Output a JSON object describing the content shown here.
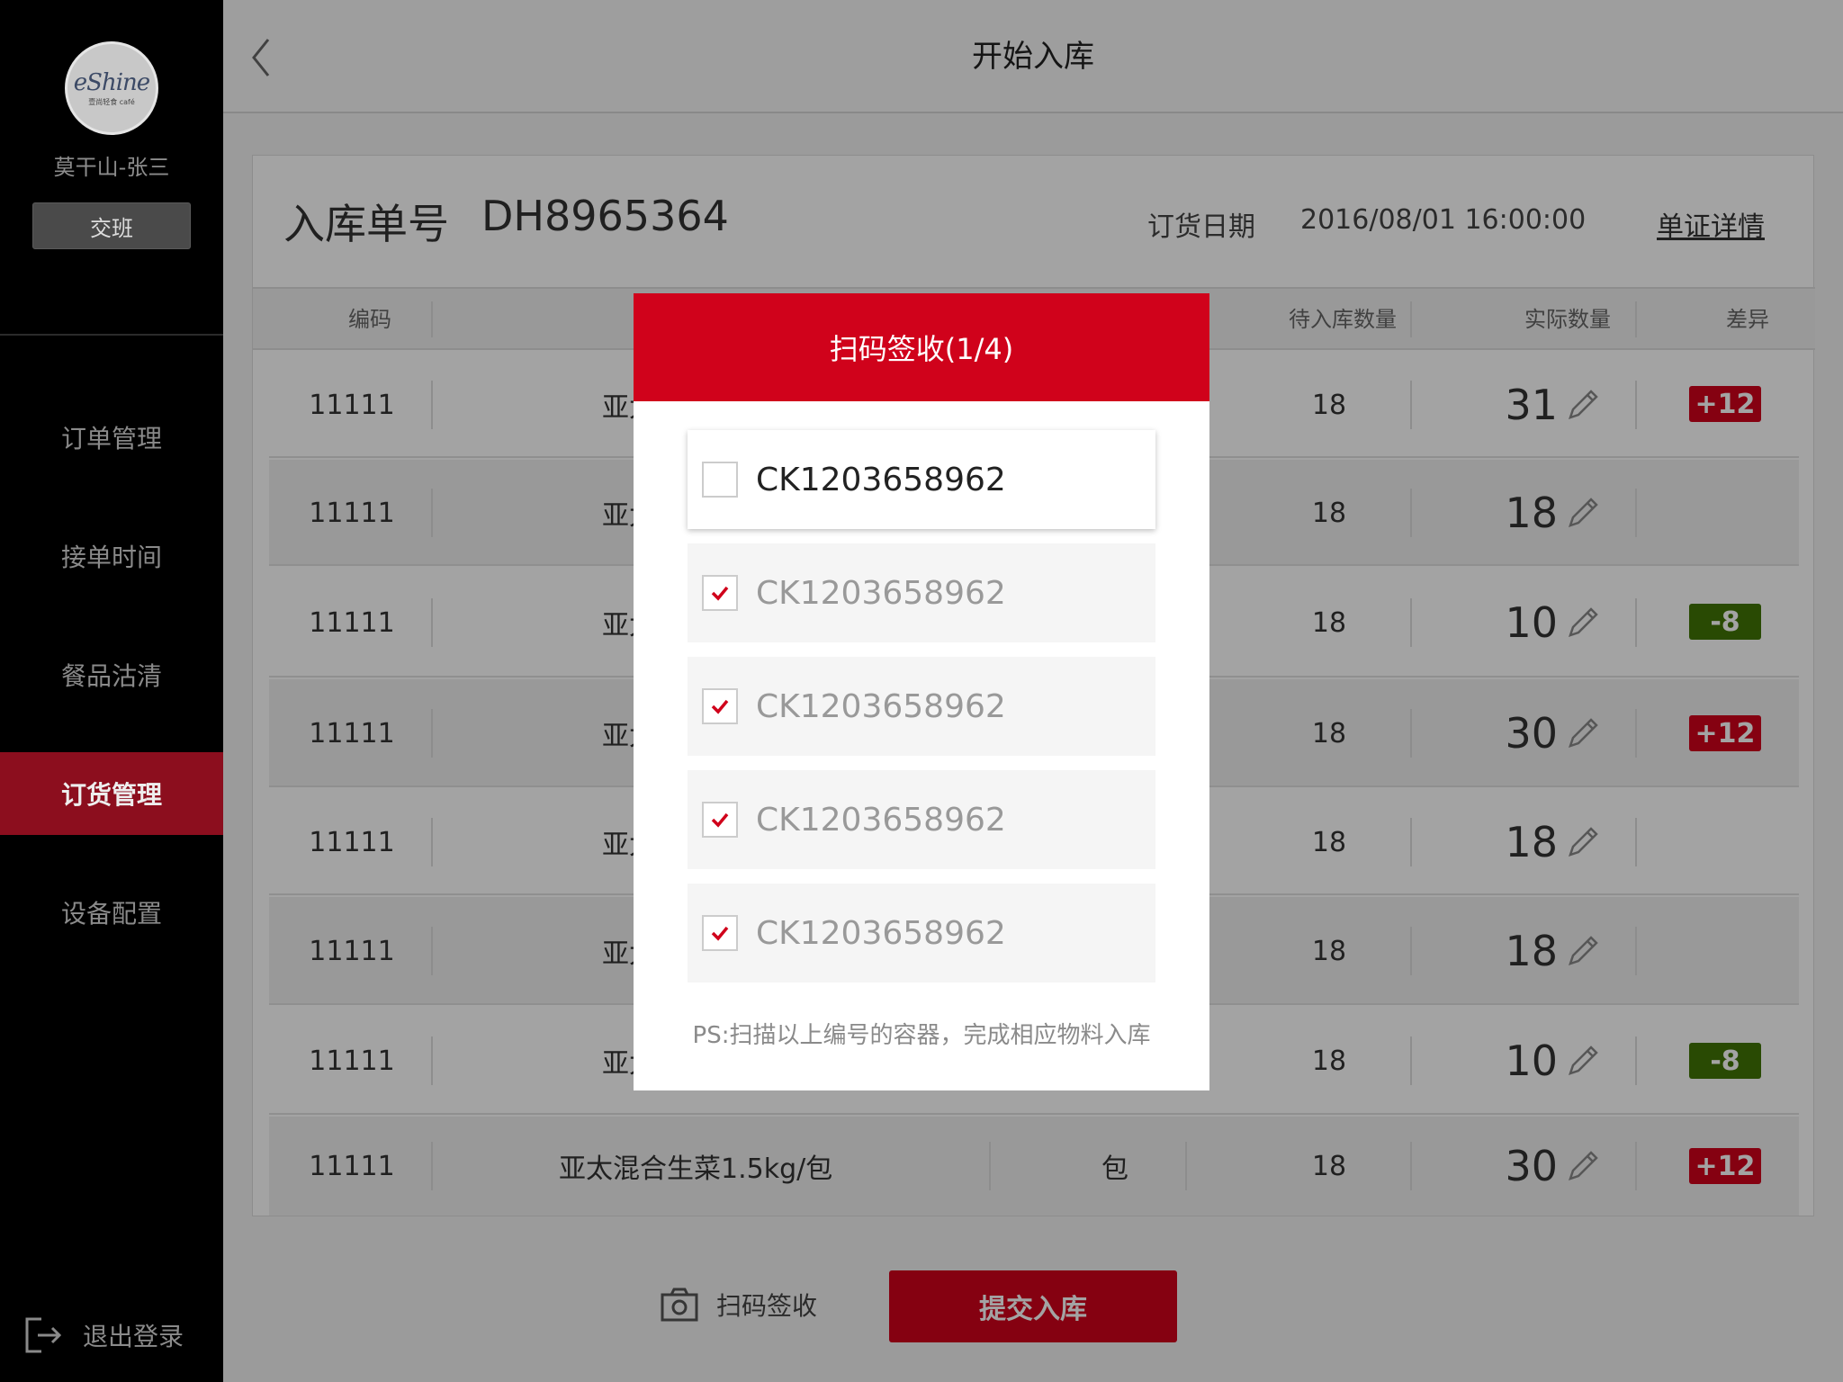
{
  "sidebar": {
    "logo_text": "eShine",
    "logo_sub": "壹尚轻食 café",
    "user_name": "莫干山-张三",
    "shift_label": "交班",
    "items": [
      {
        "label": "订单管理"
      },
      {
        "label": "接单时间"
      },
      {
        "label": "餐品沽清"
      },
      {
        "label": "订货管理"
      },
      {
        "label": "设备配置"
      }
    ],
    "active_index": 3,
    "logout_label": "退出登录"
  },
  "topbar": {
    "title": "开始入库"
  },
  "order": {
    "number_label": "入库单号",
    "number": "DH8965364",
    "date_label": "订货日期",
    "date": "2016/08/01 16:00:00",
    "detail_link": "单证详情"
  },
  "table": {
    "headers": {
      "code": "编码",
      "pending": "待入库数量",
      "actual": "实际数量",
      "diff": "差异"
    },
    "rows": [
      {
        "code": "11111",
        "name": "亚太",
        "pending": "18",
        "actual": "31",
        "diff": "+12"
      },
      {
        "code": "11111",
        "name": "亚太",
        "pending": "18",
        "actual": "18",
        "diff": ""
      },
      {
        "code": "11111",
        "name": "亚太",
        "pending": "18",
        "actual": "10",
        "diff": "-8"
      },
      {
        "code": "11111",
        "name": "亚太",
        "pending": "18",
        "actual": "30",
        "diff": "+12"
      },
      {
        "code": "11111",
        "name": "亚太",
        "pending": "18",
        "actual": "18",
        "diff": ""
      },
      {
        "code": "11111",
        "name": "亚太",
        "pending": "18",
        "actual": "18",
        "diff": ""
      },
      {
        "code": "11111",
        "name": "亚太",
        "pending": "18",
        "actual": "10",
        "diff": "-8"
      },
      {
        "code": "11111",
        "name": "亚太混合生菜1.5kg/包",
        "unit": "包",
        "pending": "18",
        "actual": "30",
        "diff": "+12"
      }
    ]
  },
  "bottom": {
    "scan_label": "扫码签收",
    "submit_label": "提交入库"
  },
  "modal": {
    "title": "扫码签收(1/4)",
    "codes": [
      {
        "code": "CK1203658962",
        "checked": false
      },
      {
        "code": "CK1203658962",
        "checked": true
      },
      {
        "code": "CK1203658962",
        "checked": true
      },
      {
        "code": "CK1203658962",
        "checked": true
      },
      {
        "code": "CK1203658962",
        "checked": true
      }
    ],
    "note": "PS:扫描以上编号的容器，完成相应物料入库"
  },
  "colors": {
    "accent": "#d0021b",
    "positive_badge": "#d0021b",
    "negative_badge": "#417505",
    "active_nav": "#8c0e1e"
  }
}
